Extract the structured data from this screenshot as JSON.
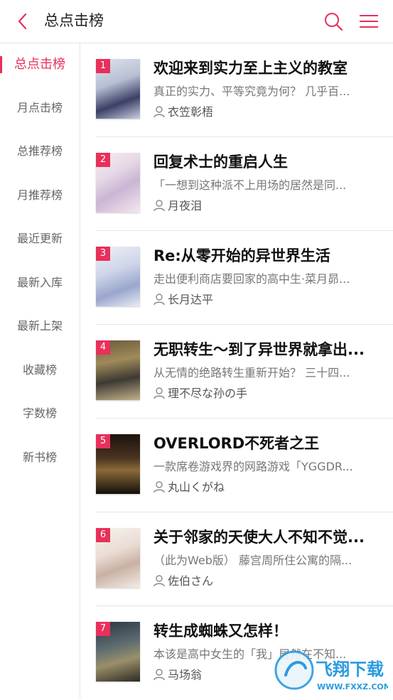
{
  "header": {
    "title": "总点击榜",
    "back_icon": "chevron-left-icon",
    "search_icon": "search-icon",
    "menu_icon": "hamburger-menu-icon",
    "accent_color": "#e8305a"
  },
  "sidebar": {
    "items": [
      {
        "label": "总点击榜",
        "active": true
      },
      {
        "label": "月点击榜"
      },
      {
        "label": "总推荐榜"
      },
      {
        "label": "月推荐榜"
      },
      {
        "label": "最近更新"
      },
      {
        "label": "最新入库"
      },
      {
        "label": "最新上架"
      },
      {
        "label": "收藏榜"
      },
      {
        "label": "字数榜"
      },
      {
        "label": "新书榜"
      }
    ]
  },
  "books": [
    {
      "rank": "1",
      "title": "欢迎来到实力至上主义的教室",
      "desc": "真正的实力、平等究竟为何？ 几乎百...",
      "author": "衣笠彰梧"
    },
    {
      "rank": "2",
      "title": "回复术士的重启人生",
      "desc": "「一想到这种派不上用场的居然是同...",
      "author": "月夜泪"
    },
    {
      "rank": "3",
      "title": "Re:从零开始的异世界生活",
      "desc": "走出便利商店要回家的高中生·菜月昴...",
      "author": "长月达平"
    },
    {
      "rank": "4",
      "title": "无职转生～到了异世界就拿出...",
      "desc": "从无情的绝路转生重新开始？ 三十四...",
      "author": "理不尽な孙の手"
    },
    {
      "rank": "5",
      "title": "OVERLORD不死者之王",
      "desc": "一款席卷游戏界的网路游戏「YGGDR...",
      "author": "丸山くがね"
    },
    {
      "rank": "6",
      "title": "关于邻家的天使大人不知不觉...",
      "desc": "（此为Web版） 藤宫周所住公寓的隔...",
      "author": "佐伯さん"
    },
    {
      "rank": "7",
      "title": "转生成蜘蛛又怎样！",
      "desc": "本该是高中女生的「我」居然在不知...",
      "author": "马场翁"
    }
  ],
  "watermark": {
    "text": "飞翔下载",
    "url_text": "WWW.FXXZ.COM"
  }
}
